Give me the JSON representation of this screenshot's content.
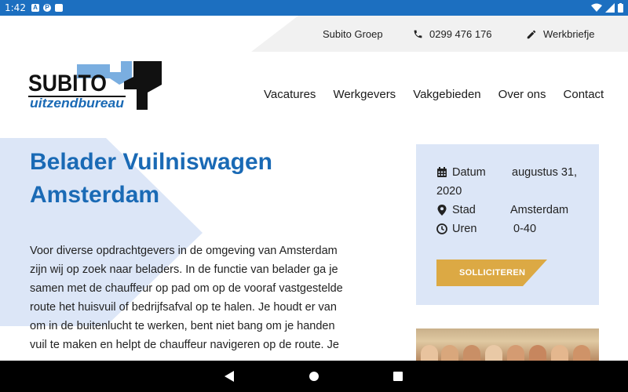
{
  "status_bar": {
    "time": "1:42"
  },
  "utility_bar": {
    "group_label": "Subito Groep",
    "phone": "0299 476 176",
    "timesheet_label": "Werkbriefje"
  },
  "logo": {
    "line1": "SUBITO",
    "line2": "uitzendbureau"
  },
  "nav": {
    "items": [
      "Vacatures",
      "Werkgevers",
      "Vakgebieden",
      "Over ons",
      "Contact"
    ]
  },
  "job": {
    "title_line1": "Belader Vuilniswagen",
    "title_line2": "Amsterdam",
    "description_lines": [
      "Voor diverse opdrachtgevers in de omgeving van Amsterdam",
      "zijn wij op zoek naar beladers. In de functie van belader ga je",
      "samen met de chauffeur op pad om op de vooraf vastgestelde",
      "route het huisvuil of bedrijfsafval op te halen. Je houdt er van",
      "om in de buitenlucht te werken, bent niet bang om je handen",
      "vuil te maken en helpt de chauffeur navigeren op de route. Je"
    ]
  },
  "info_card": {
    "date_label": "Datum",
    "date_value_line1": "augustus 31,",
    "date_value_line2": "2020",
    "city_label": "Stad",
    "city_value": "Amsterdam",
    "hours_label": "Uren",
    "hours_value": "0-40",
    "apply_label": "SOLLICITEREN"
  },
  "colors": {
    "brand_blue": "#1a6ab5",
    "status_bar": "#1c6fc0",
    "light_blue_bg": "#dce6f7",
    "apply_button": "#dca944"
  }
}
